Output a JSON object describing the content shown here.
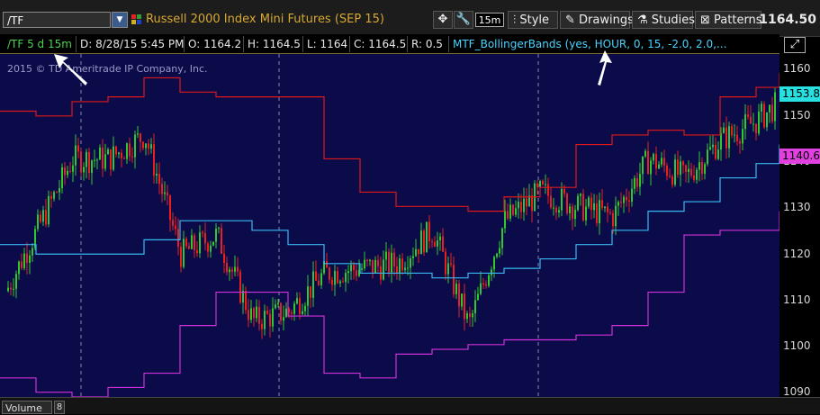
{
  "toolbar": {
    "symbol": "/TF",
    "description": "Russell 2000 Index Mini Futures (SEP 15)",
    "timeframe_badge": "15m",
    "style_label": "Style",
    "drawings_label": "Drawings",
    "studies_label": "Studies",
    "patterns_label": "Patterns",
    "last_price": "1164.50"
  },
  "info_bar": {
    "period": "/TF 5 d 15m",
    "date": "D: 8/28/15 5:45 PM",
    "open": "O: 1164.2",
    "high": "H: 1164.5",
    "low": "L: 1164",
    "close": "C: 1164.5",
    "range": "R: 0.5",
    "study": "MTF_BollingerBands (yes, HOUR, 0, 15, -2.0, 2.0,..."
  },
  "chart": {
    "copyright": "2015 © TD Ameritrade IP Company, Inc.",
    "price_tag_last": "1153.8",
    "price_tag_mid": "1140.6",
    "y_ticks": [
      "1160",
      "1150",
      "1140",
      "1130",
      "1120",
      "1110",
      "1100",
      "1090"
    ],
    "colors": {
      "background": "#0b0b4a",
      "upper_band": "#e01818",
      "middle_band": "#38b8f0",
      "lower_band": "#d030d8",
      "candle_up": "#30c830",
      "candle_down": "#e82020",
      "last_tag": "#28e0e0",
      "mid_tag": "#e040e0"
    }
  },
  "chart_data": {
    "type": "line",
    "title": "Russell 2000 Index Mini Futures (SEP 15)",
    "ylim": [
      1090,
      1162
    ],
    "x": [
      0,
      40,
      80,
      120,
      160,
      200,
      240,
      280,
      320,
      360,
      400,
      440,
      480,
      520,
      560,
      600,
      640,
      680,
      720,
      760,
      800,
      840,
      866
    ],
    "series": [
      {
        "name": "upper",
        "values": [
          1150,
          1149,
          1152,
          1153,
          1157,
          1154,
          1153,
          1153,
          1153,
          1140,
          1133,
          1130,
          1130,
          1129,
          1132,
          1134,
          1143,
          1145,
          1146,
          1145,
          1153,
          1155,
          1158
        ]
      },
      {
        "name": "middle",
        "values": [
          1122,
          1120,
          1120,
          1120,
          1123,
          1127,
          1127,
          1125,
          1122,
          1118,
          1116,
          1116,
          1115,
          1116,
          1117,
          1119,
          1122,
          1125,
          1129,
          1131,
          1136,
          1139,
          1143
        ]
      },
      {
        "name": "lower",
        "values": [
          1094,
          1091,
          1090,
          1092,
          1095,
          1105,
          1112,
          1112,
          1107,
          1095,
          1094,
          1099,
          1100,
          1101,
          1102,
          1102,
          1103,
          1105,
          1112,
          1124,
          1125,
          1125,
          1129
        ]
      },
      {
        "name": "close",
        "values": [
          1110,
          1125,
          1140,
          1140,
          1145,
          1120,
          1124,
          1106,
          1108,
          1116,
          1117,
          1118,
          1125,
          1105,
          1127,
          1133,
          1130,
          1128,
          1140,
          1136,
          1144,
          1148,
          1152
        ]
      }
    ]
  }
}
